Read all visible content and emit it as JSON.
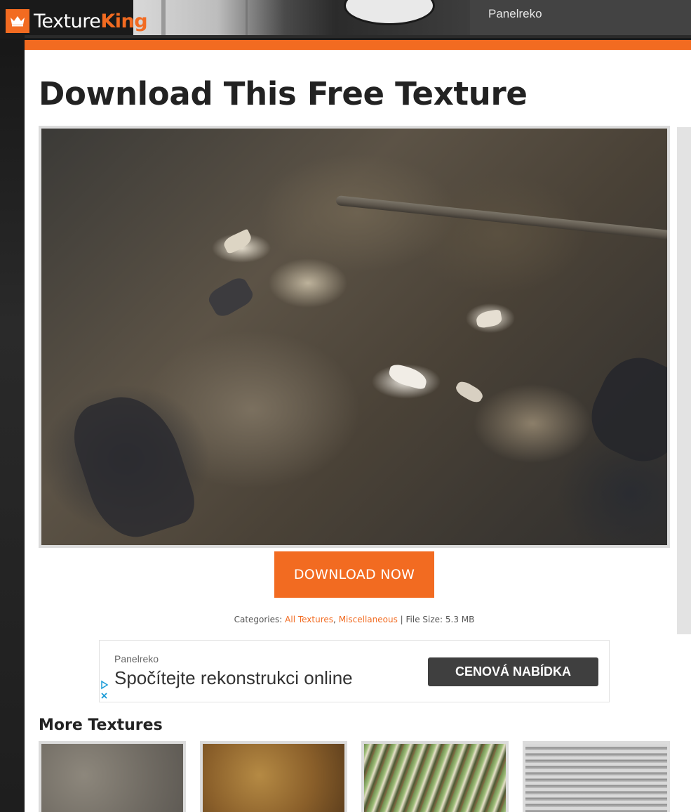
{
  "header": {
    "logo_text_primary": "Texture",
    "logo_text_accent": "King",
    "ad_banner_text": "Panelreko"
  },
  "main": {
    "page_title": "Download This Free Texture",
    "download_label": "DOWNLOAD NOW",
    "meta": {
      "categories_label": "Categories:",
      "categories": [
        "All Textures",
        "Miscellaneous"
      ],
      "separator": ",",
      "file_size_label": "| File Size: 5.3 MB"
    }
  },
  "ad": {
    "sponsor": "Panelreko",
    "headline": "Spočítejte rekonstrukci online",
    "cta": "CENOVÁ NABÍDKA"
  },
  "more": {
    "title": "More Textures"
  },
  "colors": {
    "brand_orange": "#f26b21",
    "ad_button": "#3f3f3f"
  }
}
